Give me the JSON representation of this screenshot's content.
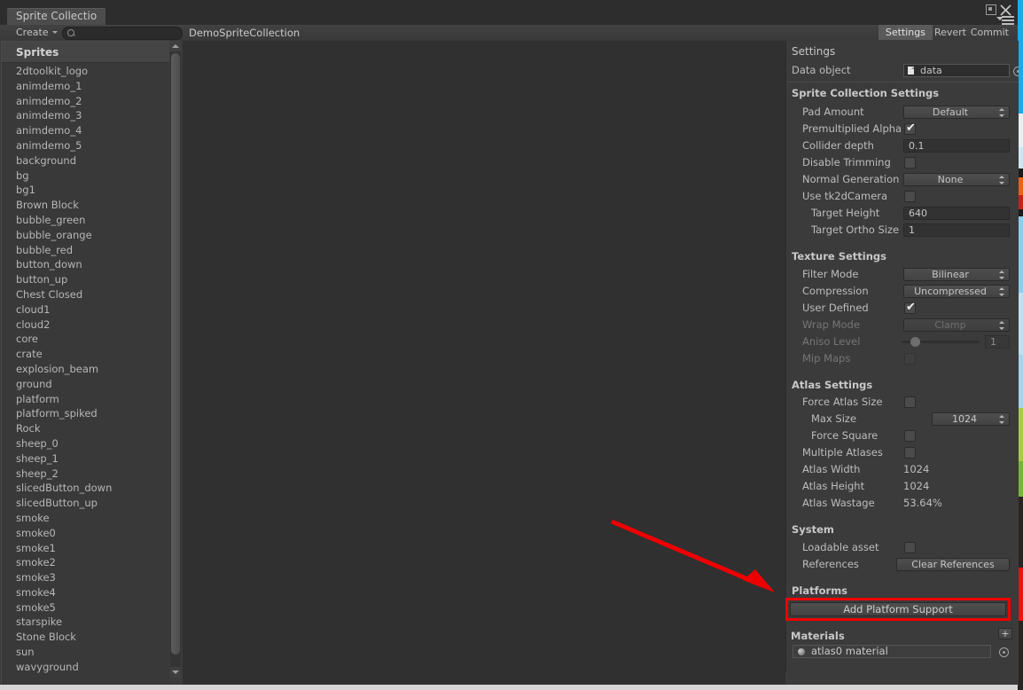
{
  "window": {
    "tab_label": "Sprite Collectio",
    "maximize_icon": "maximize-icon",
    "close_icon": "close-icon",
    "menu_icon": "hamburger-menu-icon"
  },
  "toolbar": {
    "create_label": "Create",
    "create_caret_icon": "chevron-down-icon",
    "search_icon": "search-icon",
    "search_value": "",
    "search_placeholder": "",
    "collection_name": "DemoSpriteCollection",
    "settings_label": "Settings",
    "revert_label": "Revert",
    "commit_label": "Commit"
  },
  "sprite_panel": {
    "header": "Sprites",
    "scroll_up_icon": "triangle-up-icon",
    "scroll_down_icon": "triangle-down-icon",
    "items": [
      "2dtoolkit_logo",
      "animdemo_1",
      "animdemo_2",
      "animdemo_3",
      "animdemo_4",
      "animdemo_5",
      "background",
      "bg",
      "bg1",
      "Brown Block",
      "bubble_green",
      "bubble_orange",
      "bubble_red",
      "button_down",
      "button_up",
      "Chest Closed",
      "cloud1",
      "cloud2",
      "core",
      "crate",
      "explosion_beam",
      "ground",
      "platform",
      "platform_spiked",
      "Rock",
      "sheep_0",
      "sheep_1",
      "sheep_2",
      "slicedButton_down",
      "slicedButton_up",
      "smoke",
      "smoke0",
      "smoke1",
      "smoke2",
      "smoke3",
      "smoke4",
      "smoke5",
      "starspike",
      "Stone Block",
      "sun",
      "wavyground"
    ]
  },
  "inspector": {
    "settings_heading": "Settings",
    "data_object": {
      "label": "Data object",
      "value": "data",
      "icon": "document-icon",
      "picker_icon": "object-picker-icon"
    },
    "sprite_collection_settings": {
      "title": "Sprite Collection Settings",
      "pad_amount": {
        "label": "Pad Amount",
        "value": "Default"
      },
      "premultiplied_alpha": {
        "label": "Premultiplied Alpha",
        "checked": true
      },
      "collider_depth": {
        "label": "Collider depth",
        "value": "0.1"
      },
      "disable_trimming": {
        "label": "Disable Trimming",
        "checked": false
      },
      "normal_generation": {
        "label": "Normal Generation",
        "value": "None"
      },
      "use_tk2dcamera": {
        "label": "Use tk2dCamera",
        "checked": false
      },
      "target_height": {
        "label": "Target Height",
        "value": "640"
      },
      "target_ortho_size": {
        "label": "Target Ortho Size",
        "value": "1"
      }
    },
    "texture_settings": {
      "title": "Texture Settings",
      "filter_mode": {
        "label": "Filter Mode",
        "value": "Bilinear"
      },
      "compression": {
        "label": "Compression",
        "value": "Uncompressed"
      },
      "user_defined": {
        "label": "User Defined",
        "checked": true
      },
      "wrap_mode": {
        "label": "Wrap Mode",
        "value": "Clamp",
        "disabled": true
      },
      "aniso_level": {
        "label": "Aniso Level",
        "value": "1",
        "disabled": true
      },
      "mip_maps": {
        "label": "Mip Maps",
        "checked": false,
        "disabled": true
      }
    },
    "atlas_settings": {
      "title": "Atlas Settings",
      "force_atlas_size": {
        "label": "Force Atlas Size",
        "checked": false
      },
      "max_size": {
        "label": "Max Size",
        "value": "1024"
      },
      "force_square": {
        "label": "Force Square",
        "checked": false
      },
      "multiple_atlases": {
        "label": "Multiple Atlases",
        "checked": false
      },
      "atlas_width": {
        "label": "Atlas Width",
        "value": "1024"
      },
      "atlas_height": {
        "label": "Atlas Height",
        "value": "1024"
      },
      "atlas_wastage": {
        "label": "Atlas Wastage",
        "value": "53.64%"
      }
    },
    "system": {
      "title": "System",
      "loadable_asset": {
        "label": "Loadable asset",
        "checked": false
      },
      "references": {
        "label": "References",
        "button_label": "Clear References"
      }
    },
    "platforms": {
      "title": "Platforms",
      "add_platform_label": "Add Platform Support",
      "highlight_color": "#ee0000"
    },
    "materials": {
      "title": "Materials",
      "add_label": "+",
      "entry_value": "atlas0  material",
      "entry_icon": "material-sphere-icon",
      "picker_icon": "object-picker-icon"
    }
  },
  "annotation": {
    "arrow_color": "#ee0000",
    "arrow_name": "red-pointer-arrow"
  }
}
